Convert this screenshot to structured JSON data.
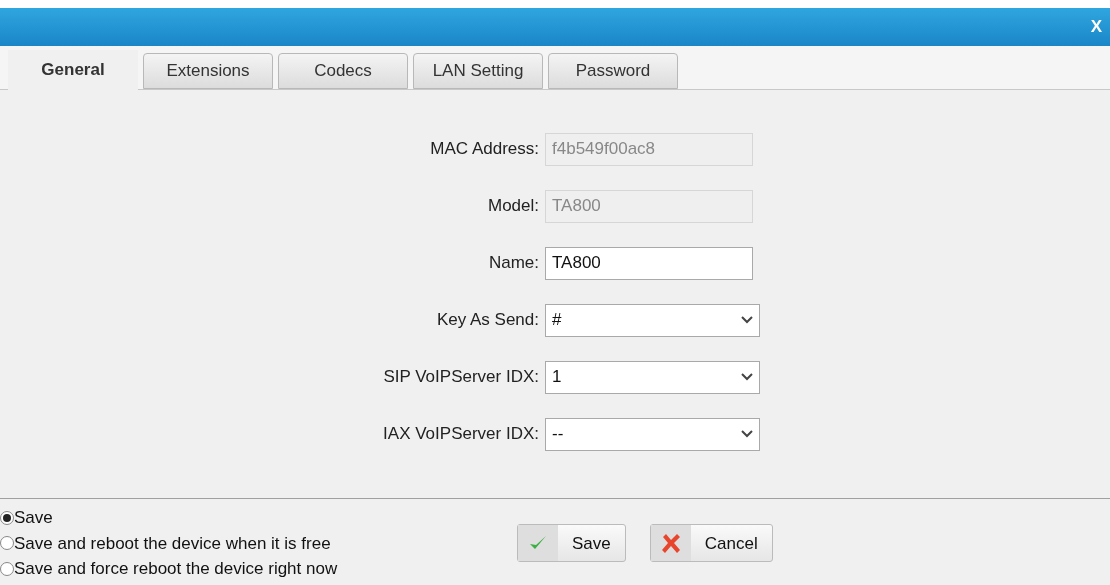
{
  "window": {
    "close": "X"
  },
  "tabs": [
    {
      "label": "General",
      "selected": true
    },
    {
      "label": "Extensions",
      "selected": false
    },
    {
      "label": "Codecs",
      "selected": false
    },
    {
      "label": "LAN Setting",
      "selected": false
    },
    {
      "label": "Password",
      "selected": false
    }
  ],
  "fields": [
    {
      "label": "MAC Address:",
      "kind": "text",
      "value": "f4b549f00ac8",
      "disabled": true
    },
    {
      "label": "Model:",
      "kind": "text",
      "value": "TA800",
      "disabled": true
    },
    {
      "label": "Name:",
      "kind": "text",
      "value": "TA800",
      "disabled": false
    },
    {
      "label": "Key As Send:",
      "kind": "select",
      "value": "#"
    },
    {
      "label": "SIP VoIPServer IDX:",
      "kind": "select",
      "value": "1"
    },
    {
      "label": "IAX VoIPServer IDX:",
      "kind": "select",
      "value": "--"
    }
  ],
  "save_options": [
    {
      "label": "Save",
      "selected": true
    },
    {
      "label": "Save and reboot the device when it is free",
      "selected": false
    },
    {
      "label": "Save and force reboot the device right now",
      "selected": false
    }
  ],
  "buttons": [
    {
      "label": "Save",
      "kind": "save"
    },
    {
      "label": "Cancel",
      "kind": "cancel"
    }
  ]
}
